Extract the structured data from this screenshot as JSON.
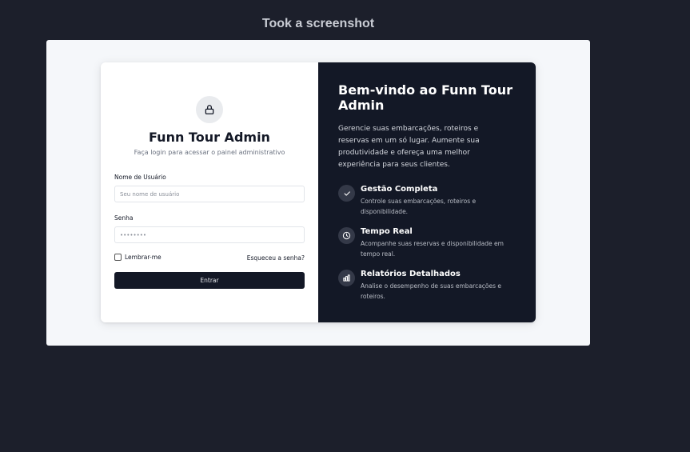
{
  "caption": "Took a screenshot",
  "login": {
    "title": "Funn Tour Admin",
    "subtitle": "Faça login para acessar o painel administrativo",
    "username_label": "Nome de Usuário",
    "username_placeholder": "Seu nome de usuário",
    "password_label": "Senha",
    "password_placeholder": "••••••••",
    "remember_label": "Lembrar-me",
    "forgot_label": "Esqueceu a senha?",
    "submit_label": "Entrar"
  },
  "promo": {
    "title": "Bem-vindo ao Funn Tour Admin",
    "intro": "Gerencie suas embarcações, roteiros e reservas em um só lugar. Aumente sua produtividade e ofereça uma melhor experiência para seus clientes.",
    "features": [
      {
        "icon": "check-icon",
        "title": "Gestão Completa",
        "desc": "Controle suas embarcações, roteiros e disponibilidade."
      },
      {
        "icon": "clock-icon",
        "title": "Tempo Real",
        "desc": "Acompanhe suas reservas e disponibilidade em tempo real."
      },
      {
        "icon": "bar-chart-icon",
        "title": "Relatórios Detalhados",
        "desc": "Analise o desempenho de suas embarcações e roteiros."
      }
    ]
  },
  "colors": {
    "background": "#1c1f2b",
    "panel_dark": "#131826",
    "accent_button": "#131826"
  }
}
